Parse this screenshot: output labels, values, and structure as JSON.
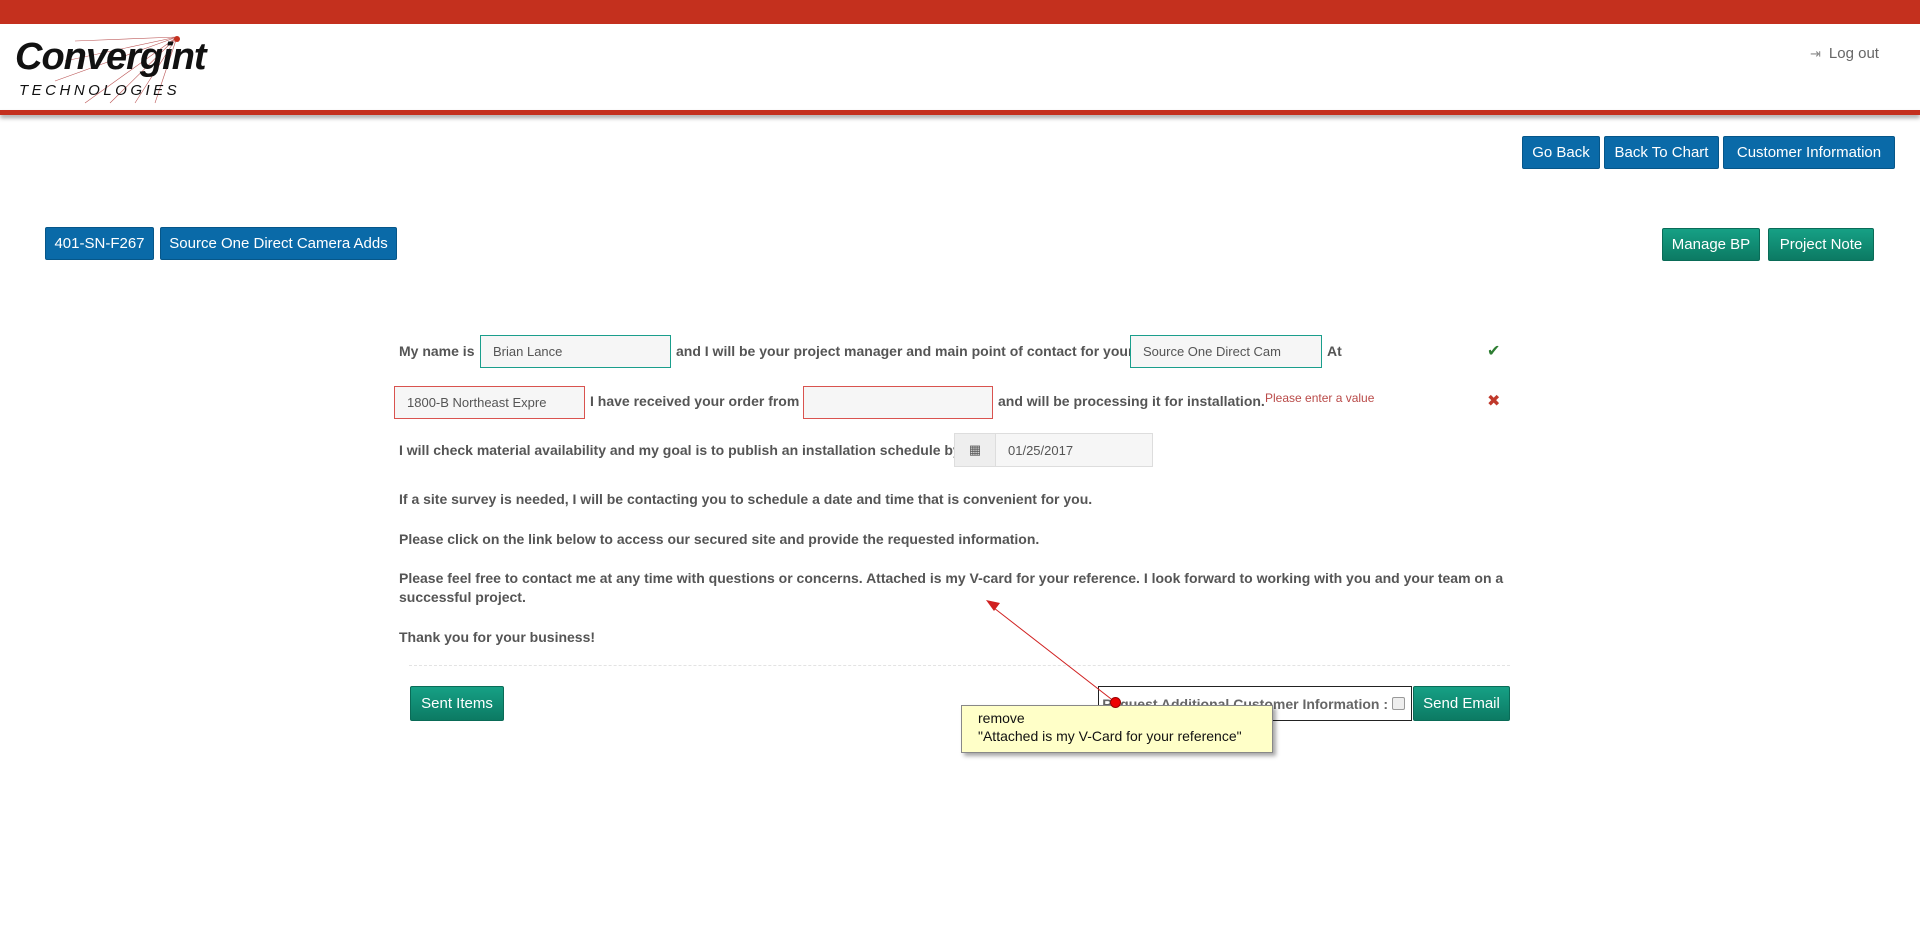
{
  "header": {
    "logo_text": "Convergint",
    "logo_subtext": "TECHNOLOGIES",
    "logout_label": "Log out",
    "logout_icon": "sign-out-icon"
  },
  "nav": {
    "go_back": "Go Back",
    "back_to_chart": "Back To Chart",
    "customer_information": "Customer Information"
  },
  "project": {
    "id": "401-SN-F267",
    "name": "Source One Direct Camera Adds",
    "manage_bp": "Manage BP",
    "project_note": "Project Note"
  },
  "form": {
    "row1": {
      "label_a": "My name is",
      "name_value": "Brian Lance",
      "label_b": "and I will be your project manager and main point of contact for your",
      "project_value": "Source One Direct Cam",
      "label_c": "At",
      "status_icon": "check-icon"
    },
    "row2": {
      "address_value": "1800-B Northeast Expre",
      "label_a": "I have received your order from",
      "order_value": "",
      "label_b": "and will be processing it for installation.",
      "error": "Please enter a value",
      "status_icon": "x-icon"
    },
    "row3": {
      "label": "I will check material availability and my goal is to publish an installation schedule by",
      "date_value": "01/25/2017",
      "date_icon": "calendar-icon"
    },
    "p1": "If a site survey is needed, I will be contacting you to schedule a date and time that is convenient for you.",
    "p2": "Please click on the link below to access our secured site and provide the requested information.",
    "p3a": "Please feel free to contact me at any time with questions or concerns. Attached is my V-card for your reference. I look forward to working with you and your team on a",
    "p3b": "successful project.",
    "p4": "Thank you for your business!"
  },
  "footer": {
    "sent_items": "Sent Items",
    "request_label": "Request Additional Customer Information :",
    "send_email": "Send Email"
  },
  "annotation": {
    "line1": "remove",
    "line2": "\"Attached is my V-Card for your reference\""
  },
  "colors": {
    "brand_red": "#c4301e",
    "blue": "#0a6aa8",
    "green": "#16a085",
    "error": "#b94a48"
  }
}
